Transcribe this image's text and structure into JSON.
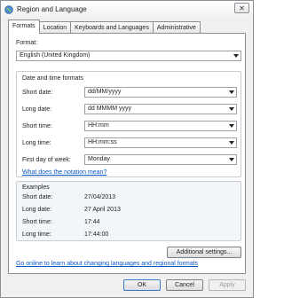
{
  "window": {
    "title": "Region and Language",
    "close_glyph": "✕"
  },
  "tabs": [
    "Formats",
    "Location",
    "Keyboards and Languages",
    "Administrative"
  ],
  "format": {
    "label": "Format:",
    "value": "English (United Kingdom)"
  },
  "date_time": {
    "title": "Date and time formats",
    "fields": [
      {
        "label": "Short date:",
        "value": "dd/MM/yyyy"
      },
      {
        "label": "Long date:",
        "value": "dd MMMM yyyy"
      },
      {
        "label": "Short time:",
        "value": "HH:mm"
      },
      {
        "label": "Long time:",
        "value": "HH:mm:ss"
      },
      {
        "label": "First day of week:",
        "value": "Monday"
      }
    ],
    "notation_link": "What does the notation mean?"
  },
  "examples": {
    "title": "Examples",
    "rows": [
      {
        "label": "Short date:",
        "value": "27/04/2013"
      },
      {
        "label": "Long date:",
        "value": "27 April 2013"
      },
      {
        "label": "Short time:",
        "value": "17:44"
      },
      {
        "label": "Long time:",
        "value": "17:44:00"
      }
    ]
  },
  "additional_settings": "Additional settings...",
  "online_link": "Go online to learn about changing languages and regional formats",
  "buttons": {
    "ok": "OK",
    "cancel": "Cancel",
    "apply": "Apply"
  },
  "icons": {
    "title": "globe-icon",
    "dropdown": "chevron-down-icon"
  }
}
